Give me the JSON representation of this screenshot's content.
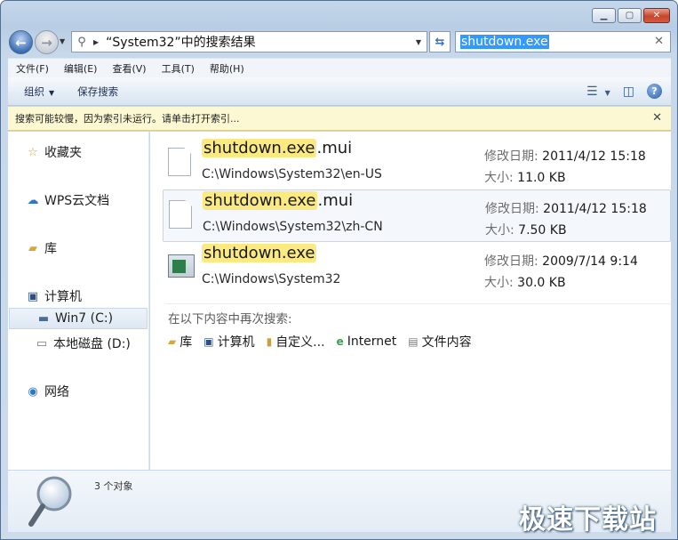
{
  "window": {
    "caption_buttons": [
      "minimize",
      "maximize",
      "close"
    ]
  },
  "address": {
    "path": "“System32”中的搜索结果"
  },
  "search": {
    "value": "shutdown.exe"
  },
  "menu": {
    "items": [
      "文件(F)",
      "编辑(E)",
      "查看(V)",
      "工具(T)",
      "帮助(H)"
    ]
  },
  "toolbar": {
    "organize_label": "组织",
    "save_search_label": "保存搜索"
  },
  "infobar": {
    "message": "搜索可能较慢，因为索引未运行。请单击打开索引..."
  },
  "sidebar": {
    "favorites": "收藏夹",
    "wps": "WPS云文档",
    "libraries": "库",
    "computer": "计算机",
    "drive_c": "Win7 (C:)",
    "drive_d": "本地磁盘 (D:)",
    "network": "网络"
  },
  "results": [
    {
      "name_match": "shutdown.exe",
      "name_rest": ".mui",
      "path": "C:\\Windows\\System32\\en-US",
      "date_label": "修改日期:",
      "date": "2011/4/12 15:18",
      "size_label": "大小:",
      "size": "11.0 KB"
    },
    {
      "name_match": "shutdown.exe",
      "name_rest": ".mui",
      "path": "C:\\Windows\\System32\\zh-CN",
      "date_label": "修改日期:",
      "date": "2011/4/12 15:18",
      "size_label": "大小:",
      "size": "7.50 KB"
    },
    {
      "name_match": "shutdown.exe",
      "name_rest": "",
      "path": "C:\\Windows\\System32",
      "date_label": "修改日期:",
      "date": "2009/7/14 9:14",
      "size_label": "大小:",
      "size": "30.0 KB"
    }
  ],
  "search_again": {
    "title": "在以下内容中再次搜索:",
    "items": [
      "库",
      "计算机",
      "自定义...",
      "Internet",
      "文件内容"
    ]
  },
  "details": {
    "count": "3 个对象"
  },
  "watermark": "极速下载站"
}
